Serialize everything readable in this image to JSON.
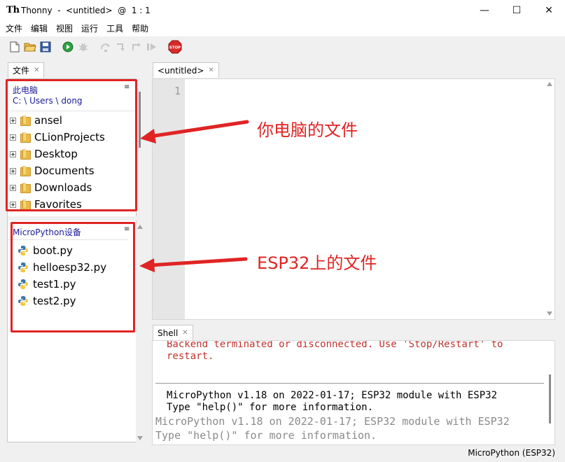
{
  "window": {
    "app_logo": "Th",
    "title": "Thonny  -  <untitled>  @  1 : 1",
    "minimize_glyph": "—",
    "maximize_glyph": "☐",
    "close_glyph": "✕"
  },
  "menu": [
    "文件",
    "编辑",
    "视图",
    "运行",
    "工具",
    "帮助"
  ],
  "toolbar": {
    "icons": [
      "new-file-icon",
      "open-folder-icon",
      "save-icon",
      "run-icon",
      "debug-icon",
      "step-over-icon",
      "step-into-icon",
      "step-out-icon",
      "resume-icon",
      "stop-icon"
    ],
    "stop_label": "STOP"
  },
  "files_panel": {
    "tab_label": "文件",
    "this_computer": {
      "title": "此电脑",
      "path": "C: \\ Users \\ dong",
      "menu_glyph": "≡",
      "items": [
        "ansel",
        "CLionProjects",
        "Desktop",
        "Documents",
        "Downloads",
        "Favorites"
      ]
    },
    "device": {
      "title": "MicroPython设备",
      "menu_glyph": "≡",
      "items": [
        "boot.py",
        "helloesp32.py",
        "test1.py",
        "test2.py"
      ]
    }
  },
  "editor": {
    "tab_label": "<untitled>",
    "line_number": "1"
  },
  "shell": {
    "tab_label": "Shell",
    "error_lines": [
      "Backend terminated or disconnected. Use 'Stop/Restart' to",
      "restart."
    ],
    "banner_lines": [
      "MicroPython v1.18 on 2022-01-17; ESP32 module with ESP32",
      "Type \"help()\" for more information."
    ],
    "repeat_lines": [
      "MicroPython v1.18 on 2022-01-17; ESP32 module with ESP32",
      "Type \"help()\" for more information."
    ]
  },
  "statusbar": {
    "interpreter": "MicroPython (ESP32)"
  },
  "annotations": {
    "computer_files": "你电脑的文件",
    "esp32_files": "ESP32上的文件"
  },
  "colors": {
    "annotation_red": "#e02424",
    "error_red": "#c0332e",
    "section_blue": "#1a1a99"
  }
}
